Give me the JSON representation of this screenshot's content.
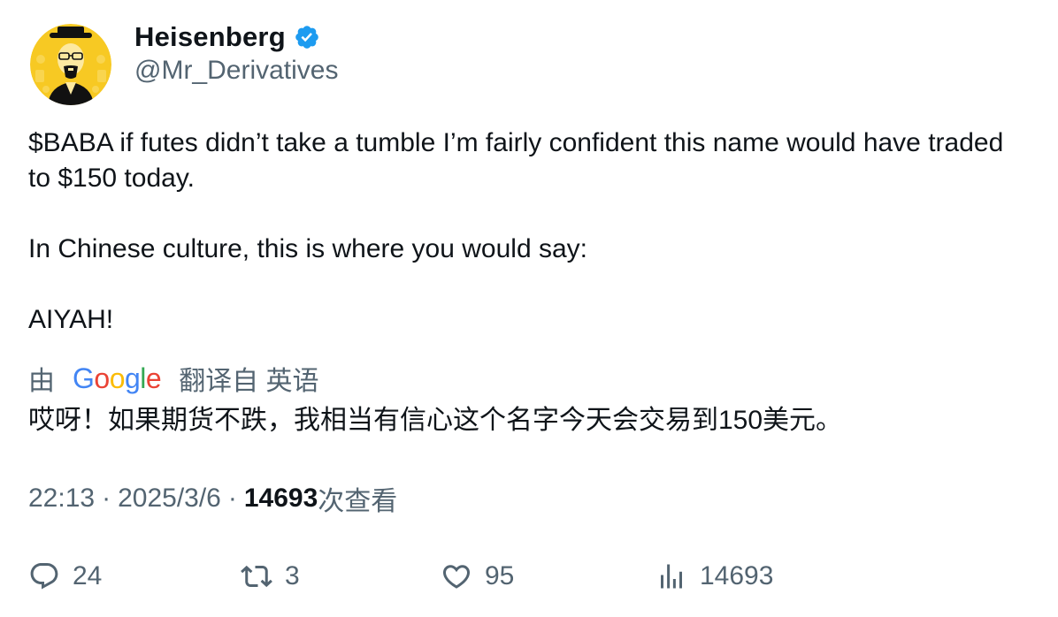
{
  "author": {
    "display_name": "Heisenberg",
    "handle": "@Mr_Derivatives",
    "verified_color": "#1d9bf0",
    "avatar_bg": "#f5c518"
  },
  "tweet": {
    "paragraphs": [
      "$BABA if futes didn’t take a tumble I’m fairly confident this name would have traded to $150 today.",
      "In Chinese culture, this is where you would say:",
      "AIYAH!"
    ]
  },
  "translation": {
    "prefix": "由",
    "provider_letters": [
      "G",
      "o",
      "o",
      "g",
      "l",
      "e"
    ],
    "provider_colors": [
      "#4285f4",
      "#ea4335",
      "#fbbc05",
      "#4285f4",
      "#34a853",
      "#ea4335"
    ],
    "suffix": "翻译自 英语",
    "text": "哎呀！如果期货不跌，我相当有信心这个名字今天会交易到150美元。"
  },
  "meta": {
    "time": "22:13",
    "separator": "·",
    "date": "2025/3/6",
    "views_count": "14693",
    "views_label": "次查看"
  },
  "actions": {
    "reply_count": "24",
    "retweet_count": "3",
    "like_count": "95",
    "views_count": "14693"
  }
}
